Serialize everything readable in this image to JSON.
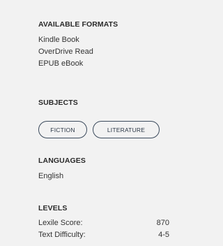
{
  "formats": {
    "heading": "AVAILABLE FORMATS",
    "items": [
      "Kindle Book",
      "OverDrive Read",
      "EPUB eBook"
    ]
  },
  "subjects": {
    "heading": "SUBJECTS",
    "tags": [
      "FICTION",
      "LITERATURE"
    ]
  },
  "languages": {
    "heading": "LANGUAGES",
    "items": [
      "English"
    ]
  },
  "levels": {
    "heading": "LEVELS",
    "rows": [
      {
        "label": "Lexile Score:",
        "value": "870"
      },
      {
        "label": "Text Difficulty:",
        "value": "4-5"
      }
    ]
  }
}
